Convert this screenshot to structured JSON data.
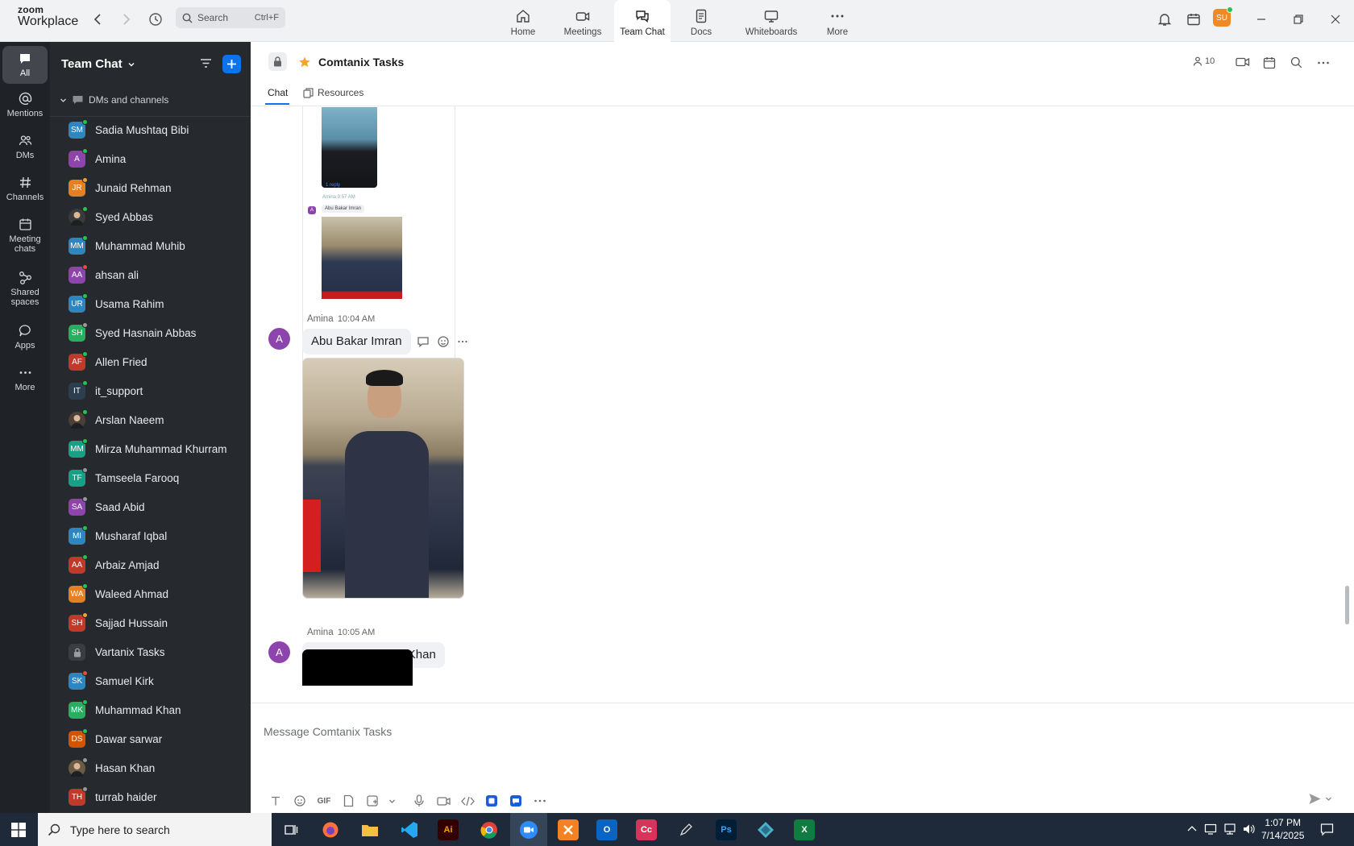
{
  "app": {
    "logo_top": "zoom",
    "logo_bottom": "Workplace"
  },
  "search": {
    "placeholder": "Search",
    "shortcut": "Ctrl+F"
  },
  "nav": [
    {
      "label": "Home",
      "icon": "home-icon"
    },
    {
      "label": "Meetings",
      "icon": "video-icon"
    },
    {
      "label": "Team Chat",
      "icon": "chat-icon"
    },
    {
      "label": "Docs",
      "icon": "doc-icon"
    },
    {
      "label": "Whiteboards",
      "icon": "whiteboard-icon"
    },
    {
      "label": "More",
      "icon": "more-icon"
    }
  ],
  "user_avatar": "SU",
  "rail": [
    {
      "label": "All"
    },
    {
      "label": "Mentions"
    },
    {
      "label": "DMs"
    },
    {
      "label": "Channels"
    },
    {
      "label": "Meeting chats"
    },
    {
      "label": "Shared spaces"
    },
    {
      "label": "Apps"
    },
    {
      "label": "More"
    }
  ],
  "sidebar": {
    "title": "Team Chat",
    "section": "DMs and channels",
    "contacts": [
      {
        "initials": "SM",
        "name": "Sadia Mushtaq Bibi",
        "color": "#2e86c1",
        "status": "#26c24f"
      },
      {
        "initials": "A",
        "name": "Amina",
        "color": "#8e44ad",
        "status": "#26c24f"
      },
      {
        "initials": "JR",
        "name": "Junaid Rehman",
        "color": "#e67e22",
        "status": "#f0a030"
      },
      {
        "initials": "",
        "name": "Syed Abbas",
        "color": "#3a3a3a",
        "status": "#26c24f"
      },
      {
        "initials": "MM",
        "name": "Muhammad Muhib",
        "color": "#2e86c1",
        "status": "#26c24f"
      },
      {
        "initials": "AA",
        "name": "ahsan ali",
        "color": "#8e44ad",
        "status": "#e74c3c"
      },
      {
        "initials": "UR",
        "name": "Usama Rahim",
        "color": "#2e86c1",
        "status": "#26c24f"
      },
      {
        "initials": "SH",
        "name": "Syed Hasnain Abbas",
        "color": "#27ae60",
        "status": "#999999"
      },
      {
        "initials": "AF",
        "name": "Allen Fried",
        "color": "#c0392b",
        "status": "#26c24f"
      },
      {
        "initials": "IT",
        "name": "it_support",
        "color": "#2c3e50",
        "status": "#26c24f"
      },
      {
        "initials": "",
        "name": "Arslan Naeem",
        "color": "#4a4038",
        "status": "#26c24f"
      },
      {
        "initials": "MM",
        "name": "Mirza Muhammad Khurram",
        "color": "#16a085",
        "status": "#26c24f"
      },
      {
        "initials": "TF",
        "name": "Tamseela Farooq",
        "color": "#16a085",
        "status": "#999999"
      },
      {
        "initials": "SA",
        "name": "Saad Abid",
        "color": "#8e44ad",
        "status": "#999999"
      },
      {
        "initials": "MI",
        "name": "Musharaf Iqbal",
        "color": "#2e86c1",
        "status": "#26c24f"
      },
      {
        "initials": "AA",
        "name": "Arbaiz Amjad",
        "color": "#c0392b",
        "status": "#26c24f"
      },
      {
        "initials": "WA",
        "name": "Waleed Ahmad",
        "color": "#e67e22",
        "status": "#26c24f"
      },
      {
        "initials": "SH",
        "name": "Sajjad Hussain",
        "color": "#c0392b",
        "status": "#f0a030"
      },
      {
        "initials": "",
        "name": "Vartanix Tasks",
        "color": "#3a3d42",
        "status": ""
      },
      {
        "initials": "SK",
        "name": "Samuel Kirk",
        "color": "#2e86c1",
        "status": "#e74c3c"
      },
      {
        "initials": "MK",
        "name": "Muhammad Khan",
        "color": "#27ae60",
        "status": "#26c24f"
      },
      {
        "initials": "DS",
        "name": "Dawar sarwar",
        "color": "#d35400",
        "status": "#26c24f"
      },
      {
        "initials": "",
        "name": "Hasan Khan",
        "color": "#6b5a44",
        "status": "#999999"
      },
      {
        "initials": "TH",
        "name": "turrab haider",
        "color": "#c0392b",
        "status": "#999999"
      }
    ]
  },
  "channel": {
    "title": "Comtanix Tasks",
    "member_count": "10",
    "tabs": [
      "Chat",
      "Resources"
    ]
  },
  "thread_preview": {
    "reply_text": "1 reply",
    "meta": "Amina 9:57 AM",
    "bubble": "Abu Bakar Imran",
    "avatar": "A"
  },
  "messages": [
    {
      "sender": "Amina",
      "time": "10:04 AM",
      "avatar": "A",
      "text": "Abu Bakar Imran"
    },
    {
      "sender": "Amina",
      "time": "10:05 AM",
      "avatar": "A",
      "text": "Muhammad Ayez Khan"
    }
  ],
  "composer": {
    "placeholder": "Message Comtanix Tasks",
    "gif": "GIF"
  },
  "taskbar": {
    "search_placeholder": "Type here to search",
    "time": "1:07 PM",
    "date": "7/14/2025"
  }
}
